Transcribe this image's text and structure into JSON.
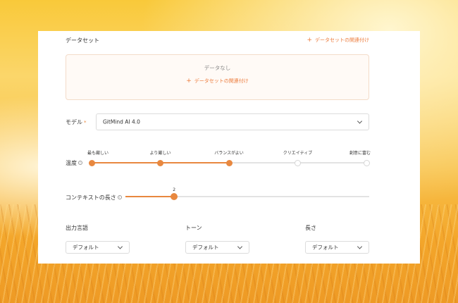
{
  "dataset": {
    "title": "データセット",
    "link": "データセットの関連付け",
    "empty_text": "データなし",
    "box_link": "データセットの関連付け"
  },
  "model": {
    "label": "モデル",
    "required_mark": "*",
    "value": "GitMind AI 4.0"
  },
  "temperature": {
    "label": "温度",
    "steps": [
      "最も厳しい",
      "より厳しい",
      "バランスがよい",
      "クリエイティブ",
      "創意に富む"
    ],
    "selected_index": 2
  },
  "context": {
    "label": "コンテキストの長さ",
    "value": "2",
    "fraction": 0.2
  },
  "options": [
    {
      "label": "出力言語",
      "value": "デフォルト"
    },
    {
      "label": "トーン",
      "value": "デフォルト"
    },
    {
      "label": "長さ",
      "value": "デフォルト"
    }
  ],
  "colors": {
    "accent": "#e8883f",
    "link": "#ec7a3a",
    "background": "#f8c24a"
  }
}
